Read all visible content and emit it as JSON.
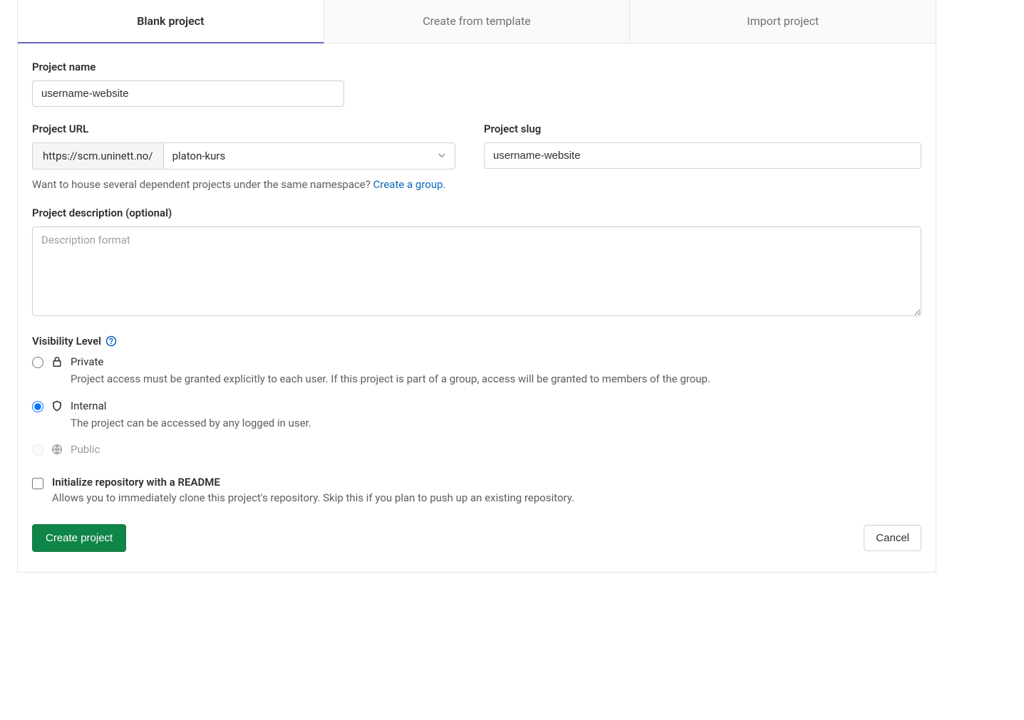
{
  "tabs": {
    "blank": "Blank project",
    "template": "Create from template",
    "import": "Import project"
  },
  "form": {
    "project_name_label": "Project name",
    "project_name_value": "username-website",
    "project_url_label": "Project URL",
    "project_url_prefix": "https://scm.uninett.no/",
    "namespace_selected": "platon-kurs",
    "project_slug_label": "Project slug",
    "project_slug_value": "username-website",
    "group_hint_text": "Want to house several dependent projects under the same namespace? ",
    "group_link_text": "Create a group.",
    "description_label": "Project description (optional)",
    "description_placeholder": "Description format",
    "visibility_label": "Visibility Level",
    "visibility": {
      "private": {
        "title": "Private",
        "desc": "Project access must be granted explicitly to each user. If this project is part of a group, access will be granted to members of the group."
      },
      "internal": {
        "title": "Internal",
        "desc": "The project can be accessed by any logged in user."
      },
      "public": {
        "title": "Public"
      }
    },
    "readme_title": "Initialize repository with a README",
    "readme_desc": "Allows you to immediately clone this project's repository. Skip this if you plan to push up an existing repository."
  },
  "actions": {
    "create": "Create project",
    "cancel": "Cancel"
  }
}
